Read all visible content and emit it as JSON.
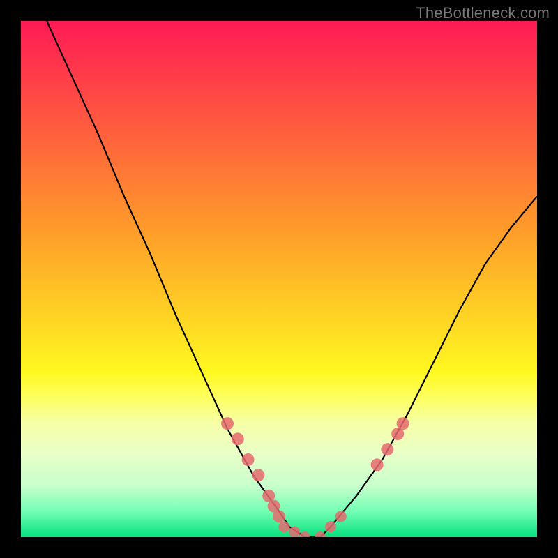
{
  "watermark": "TheBottleneck.com",
  "chart_data": {
    "type": "line",
    "title": "",
    "xlabel": "",
    "ylabel": "",
    "xlim": [
      0,
      100
    ],
    "ylim": [
      0,
      100
    ],
    "series": [
      {
        "name": "curve",
        "color": "#000000",
        "x": [
          5,
          10,
          15,
          20,
          25,
          30,
          35,
          40,
          45,
          50,
          52,
          55,
          58,
          60,
          65,
          70,
          75,
          80,
          85,
          90,
          95,
          100
        ],
        "y": [
          100,
          89,
          78,
          66,
          55,
          43,
          32,
          21,
          12,
          5,
          2,
          0,
          0,
          2,
          8,
          15,
          24,
          34,
          44,
          53,
          60,
          66
        ]
      },
      {
        "name": "markers-left",
        "color": "#e66a6f",
        "x": [
          40,
          42,
          44,
          46,
          48,
          49,
          50
        ],
        "y": [
          22,
          19,
          15,
          12,
          8,
          6,
          4
        ]
      },
      {
        "name": "markers-bottom",
        "color": "#e66a6f",
        "x": [
          51,
          53,
          55,
          58,
          60,
          62
        ],
        "y": [
          2,
          1,
          0,
          0,
          2,
          4
        ]
      },
      {
        "name": "markers-right",
        "color": "#e66a6f",
        "x": [
          69,
          71,
          73,
          74
        ],
        "y": [
          14,
          17,
          20,
          22
        ]
      }
    ]
  }
}
